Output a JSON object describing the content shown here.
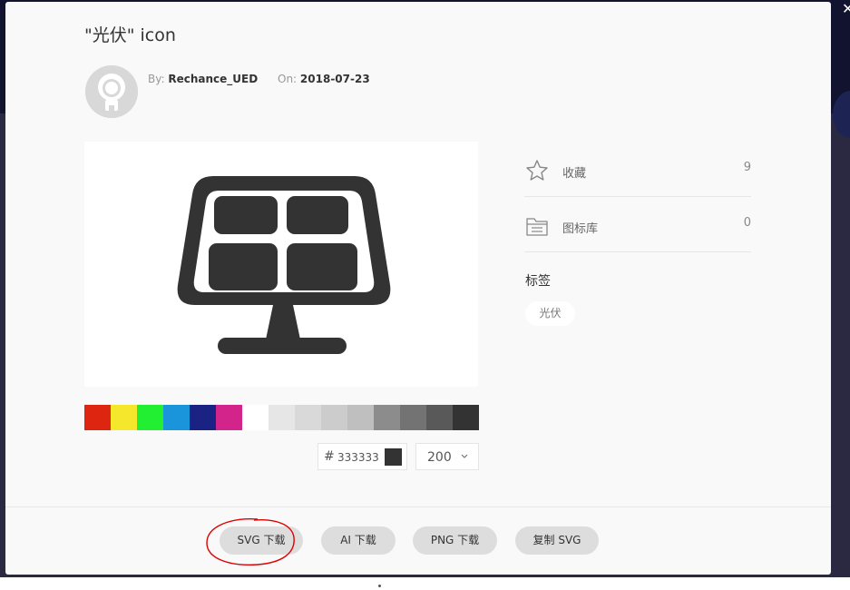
{
  "modal": {
    "title": "\"光伏\" icon",
    "author_key": "By:",
    "author_value": "Rechance_UED",
    "date_key": "On:",
    "date_value": "2018-07-23"
  },
  "preview": {
    "icon": "solar-panel-icon",
    "icon_color": "#333333"
  },
  "palette": [
    "#dd2510",
    "#f5e82c",
    "#22ef31",
    "#1a95dc",
    "#1a2284",
    "#d2248a",
    "#ffffff",
    "#e6e6e6",
    "#d9d9d9",
    "#cccccc",
    "#bfbfbf",
    "#8c8c8c",
    "#737373",
    "#595959",
    "#333333"
  ],
  "color_picker": {
    "hash": "#",
    "hex": "333333",
    "chip_color": "#333333"
  },
  "size_select": {
    "value": "200"
  },
  "sidebar": {
    "favorites_label": "收藏",
    "favorites_count": "9",
    "library_label": "图标库",
    "library_count": "0",
    "tags_heading": "标签",
    "tag": "光伏"
  },
  "buttons": {
    "svg_download": "SVG 下载",
    "ai_download": "AI 下载",
    "png_download": "PNG 下载",
    "copy_svg": "复制 SVG"
  },
  "colors": {
    "backdrop": "#2b2942",
    "modal_bg": "#f9f9f9",
    "button_bg": "#dddddd",
    "annotation": "#e00000"
  }
}
